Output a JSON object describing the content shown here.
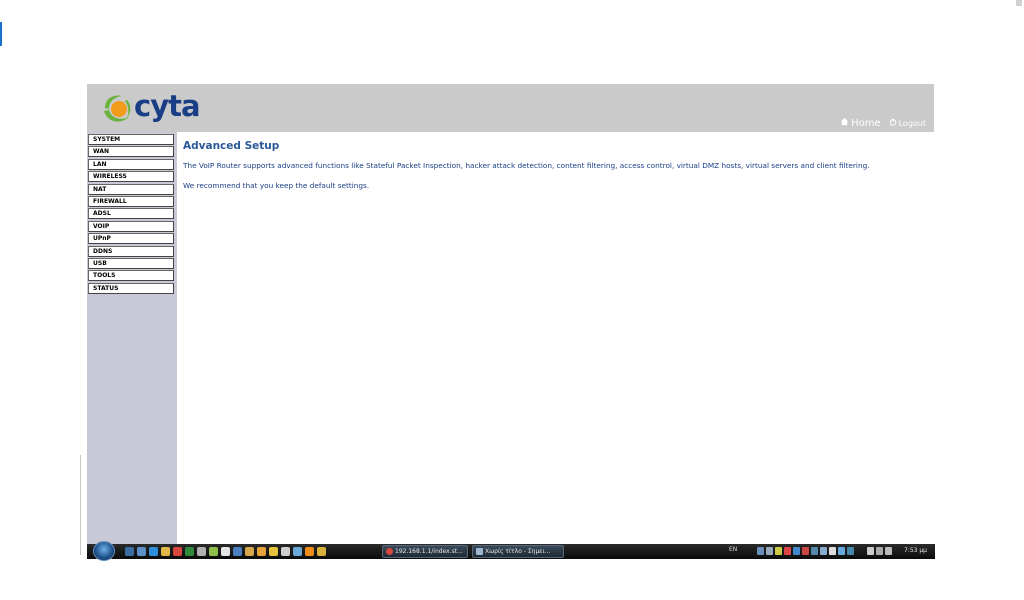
{
  "brand": {
    "logo_text": "cyta",
    "colors": {
      "logo_blue": "#1a3e86",
      "logo_green": "#6cb33e",
      "logo_orange": "#f39c1b"
    }
  },
  "header": {
    "home_label": "Home",
    "logout_label": "Logout",
    "home_icon": "house-icon",
    "logout_icon": "power-icon",
    "background": "#cacaca"
  },
  "sidebar": {
    "items": [
      {
        "label": "SYSTEM"
      },
      {
        "label": "WAN"
      },
      {
        "label": "LAN"
      },
      {
        "label": "WIRELESS"
      },
      {
        "label": "NAT"
      },
      {
        "label": "FIREWALL"
      },
      {
        "label": "ADSL"
      },
      {
        "label": "VOIP"
      },
      {
        "label": "UPnP"
      },
      {
        "label": "DDNS"
      },
      {
        "label": "USB"
      },
      {
        "label": "TOOLS"
      },
      {
        "label": "STATUS"
      }
    ]
  },
  "main": {
    "title": "Advanced Setup",
    "paragraphs": [
      "The VoIP Router supports advanced functions like Stateful Packet Inspection, hacker attack detection, content filtering, access control, virtual DMZ hosts, virtual servers and client filtering.",
      "We recommend that you keep the default settings."
    ]
  },
  "taskbar": {
    "tasks": [
      {
        "label": "192.168.1.1/index.st...",
        "icon": "chrome-icon"
      },
      {
        "label": "Χωρίς τίτλο - Σημει...",
        "icon": "notepad-icon"
      }
    ],
    "language": "EN",
    "clock": "7:53 μμ"
  }
}
